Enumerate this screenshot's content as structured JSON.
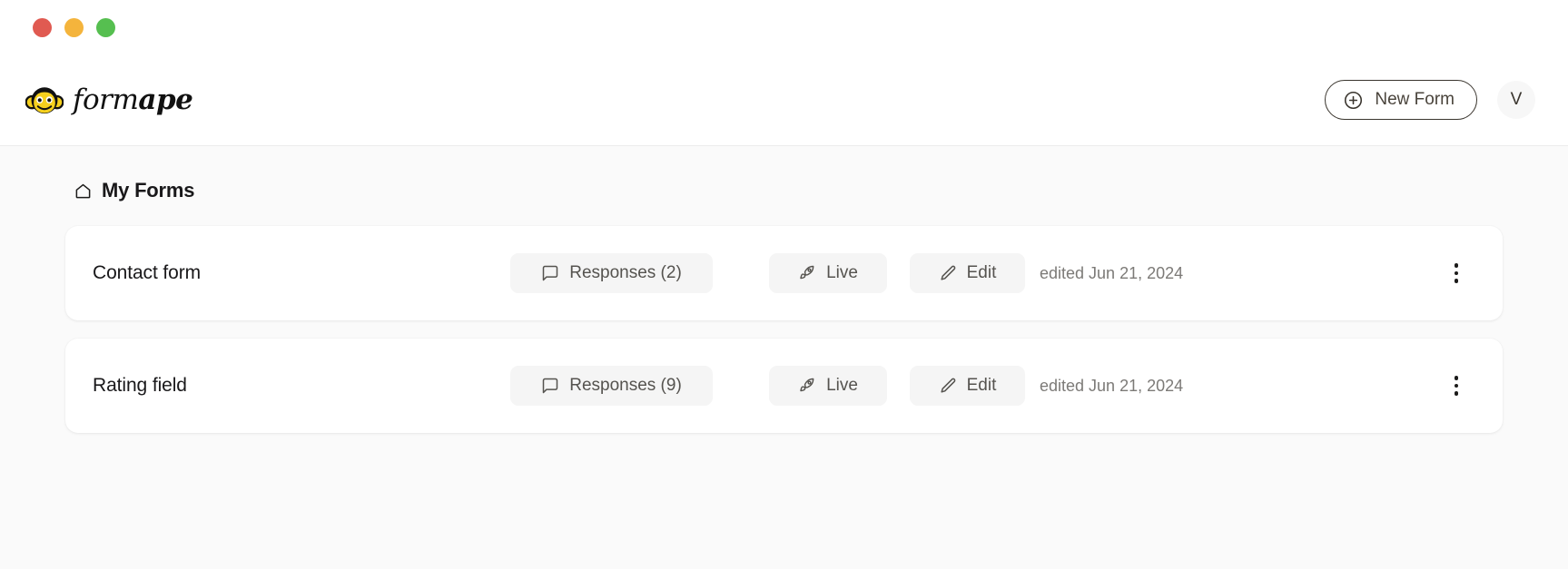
{
  "window": {
    "traffic_lights": [
      {
        "name": "close",
        "color": "#e05a51"
      },
      {
        "name": "minimize",
        "color": "#f4b43c"
      },
      {
        "name": "zoom",
        "color": "#56bf50"
      }
    ]
  },
  "header": {
    "brand": {
      "icon": "monkey-face-icon",
      "word_first": "form",
      "word_second": "ape",
      "logo_color": "#f5d01e"
    },
    "new_form": {
      "label": "New Form",
      "icon": "plus-circle-icon"
    },
    "avatar": {
      "initial": "V"
    }
  },
  "main": {
    "page_title": "My Forms",
    "page_title_icon": "home-icon",
    "forms": [
      {
        "name": "Contact form",
        "responses_label": "Responses (2)",
        "responses_icon": "message-square-icon",
        "status_label": "Live",
        "status_icon": "rocket-icon",
        "edit_label": "Edit",
        "edit_icon": "pencil-icon",
        "edited_text": "edited Jun 21, 2024",
        "menu_icon": "more-vertical-icon"
      },
      {
        "name": "Rating field",
        "responses_label": "Responses (9)",
        "responses_icon": "message-square-icon",
        "status_label": "Live",
        "status_icon": "rocket-icon",
        "edit_label": "Edit",
        "edit_icon": "pencil-icon",
        "edited_text": "edited Jun 21, 2024",
        "menu_icon": "more-vertical-icon"
      }
    ]
  },
  "colors": {
    "page_background": "#fafafa",
    "card_background": "#ffffff",
    "pill_background": "#f5f5f5",
    "text_primary": "#19181a",
    "text_muted": "#7c7a77"
  }
}
